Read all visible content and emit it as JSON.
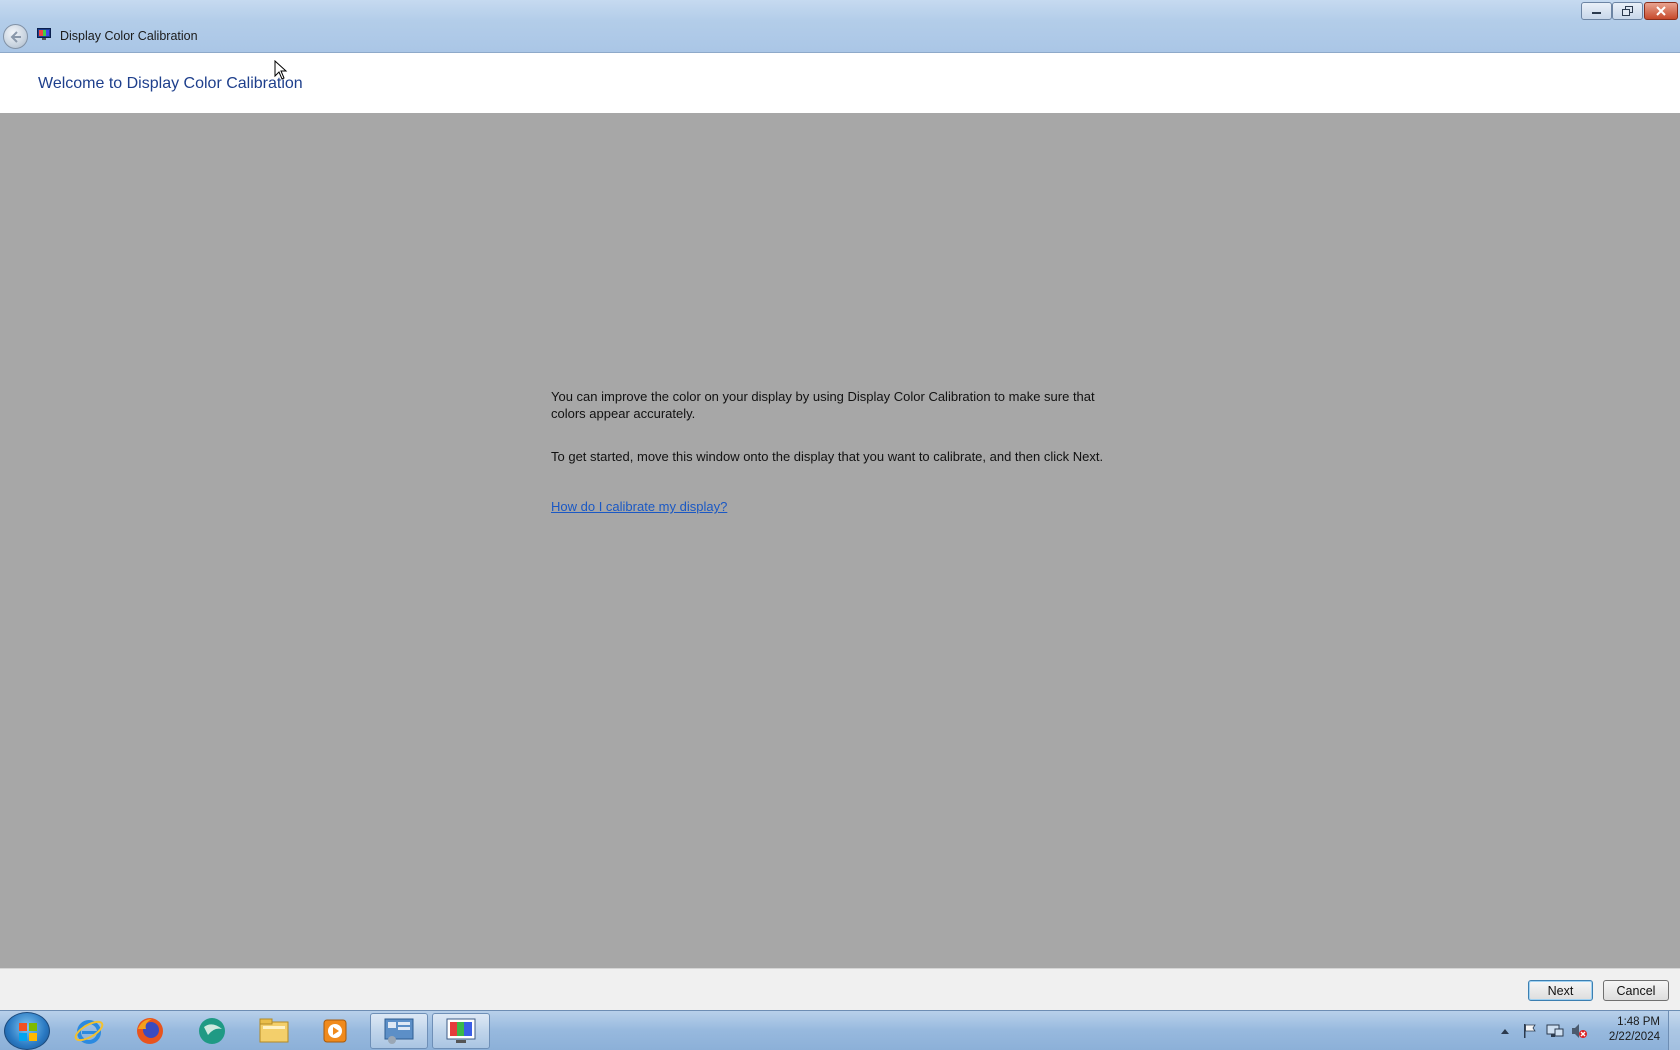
{
  "window": {
    "title": "Display Color Calibration",
    "controls": {
      "minimize": "minimize-icon",
      "maximize": "restore-icon",
      "close": "close-icon"
    }
  },
  "header": {
    "title": "Welcome to Display Color Calibration"
  },
  "content": {
    "paragraph1": "You can improve the color on your display by using Display Color Calibration to make sure that colors appear accurately.",
    "paragraph2": "To get started, move this window onto the display that you want to calibrate, and then click Next.",
    "help_link": "How do I calibrate my display?"
  },
  "footer": {
    "next_label": "Next",
    "cancel_label": "Cancel"
  },
  "taskbar": {
    "items": [
      {
        "icon": "internet-explorer-icon"
      },
      {
        "icon": "firefox-icon"
      },
      {
        "icon": "app-icon"
      },
      {
        "icon": "file-explorer-icon"
      },
      {
        "icon": "media-player-icon"
      },
      {
        "icon": "control-panel-icon"
      },
      {
        "icon": "display-calibration-icon"
      }
    ],
    "tray_icons": [
      "show-hidden-icons-icon",
      "action-center-flag-icon",
      "network-icon",
      "volume-muted-icon"
    ],
    "time": "1:48 PM",
    "date": "2/22/2024"
  },
  "colors": {
    "content_bg": "#a7a7a7",
    "header_title": "#1e3f8c",
    "link": "#1a58c4"
  }
}
